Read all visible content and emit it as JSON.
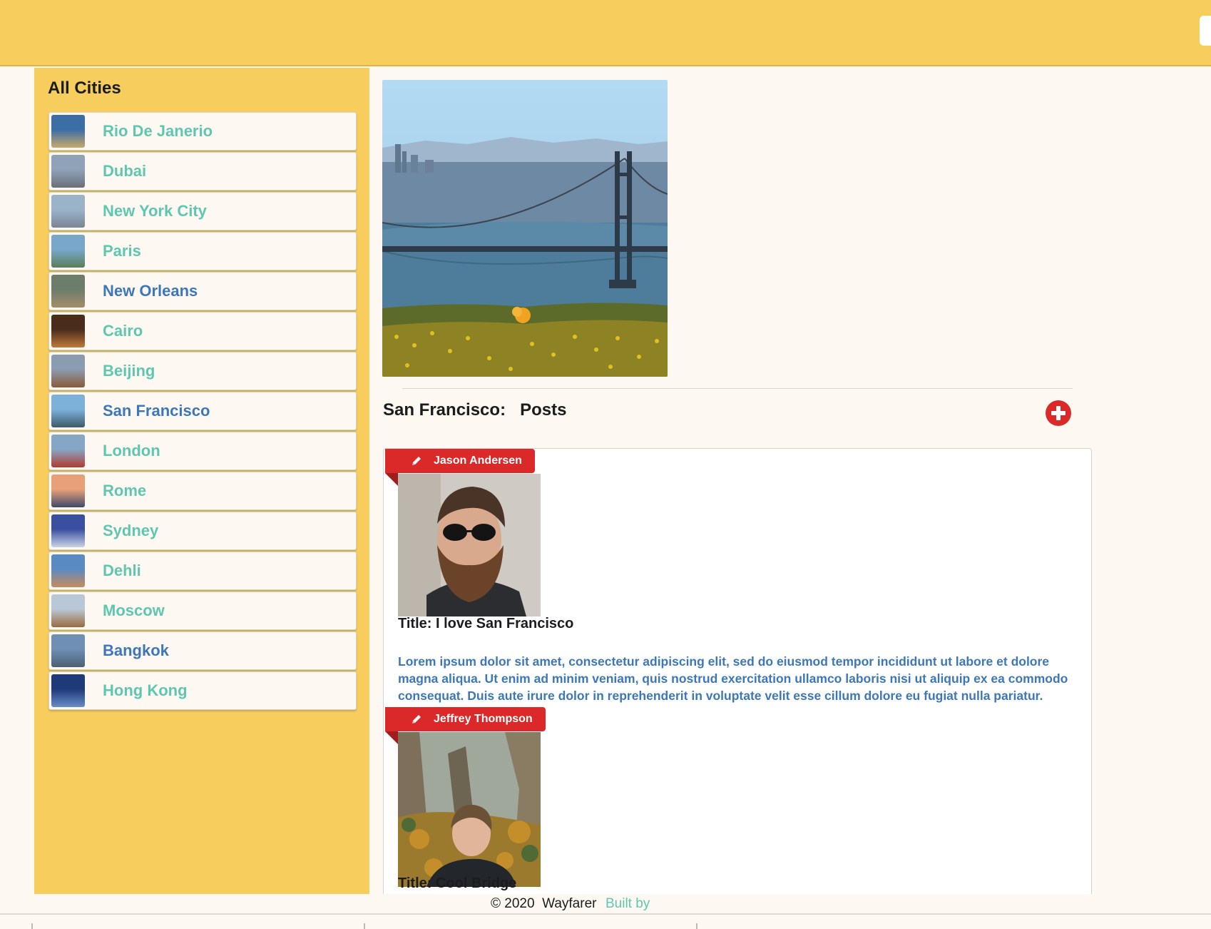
{
  "sidebar": {
    "heading": "All Cities",
    "cities": [
      {
        "name": "Rio De Janerio",
        "color": "teal"
      },
      {
        "name": "Dubai",
        "color": "teal"
      },
      {
        "name": "New York City",
        "color": "teal"
      },
      {
        "name": "Paris",
        "color": "teal"
      },
      {
        "name": "New Orleans",
        "color": "blue"
      },
      {
        "name": "Cairo",
        "color": "teal"
      },
      {
        "name": "Beijing",
        "color": "teal"
      },
      {
        "name": "San Francisco",
        "color": "blue"
      },
      {
        "name": "London",
        "color": "teal"
      },
      {
        "name": "Rome",
        "color": "teal"
      },
      {
        "name": "Sydney",
        "color": "teal"
      },
      {
        "name": "Dehli",
        "color": "teal"
      },
      {
        "name": "Moscow",
        "color": "teal"
      },
      {
        "name": "Bangkok",
        "color": "blue"
      },
      {
        "name": "Hong Kong",
        "color": "teal"
      }
    ]
  },
  "main": {
    "city": "San Francisco:",
    "posts_label": "Posts",
    "add_icon": "plus-circle-icon",
    "posts": [
      {
        "author": "Jason Andersen",
        "title": "Title: I love San Francisco",
        "body": "Lorem ipsum dolor sit amet, consectetur adipiscing elit, sed do eiusmod tempor incididunt ut labore et dolore magna aliqua. Ut enim ad minim veniam, quis nostrud exercitation ullamco laboris nisi ut aliquip ex ea commodo consequat. Duis aute irure dolor in reprehenderit in voluptate velit esse cillum dolore eu fugiat nulla pariatur."
      },
      {
        "author": "Jeffrey Thompson",
        "title": "Title: Cool Bridge",
        "body": ""
      }
    ]
  },
  "footer": {
    "copyright": "© 2020  Wayfarer",
    "built_by": "Built by"
  },
  "colors": {
    "brand_yellow": "#f7cd5d",
    "teal": "#5fc6b0",
    "blue": "#3d77b8",
    "red": "#db2828"
  }
}
